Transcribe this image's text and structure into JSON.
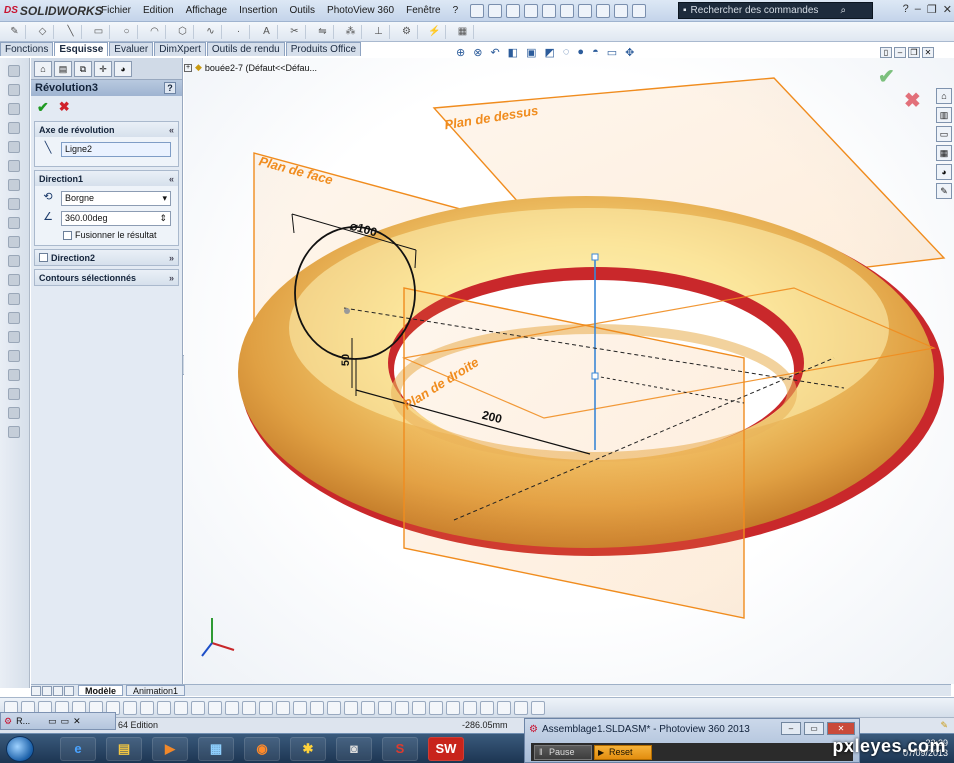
{
  "app": {
    "logo_prefix": "DS",
    "logo_name": "SOLIDWORKS"
  },
  "menu": [
    "Fichier",
    "Edition",
    "Affichage",
    "Insertion",
    "Outils",
    "PhotoView 360",
    "Fenêtre",
    "?"
  ],
  "search": {
    "placeholder": "Rechercher des commandes"
  },
  "tabs": [
    "Fonctions",
    "Esquisse",
    "Evaluer",
    "DimXpert",
    "Outils de rendu",
    "Produits Office"
  ],
  "active_tab": "Esquisse",
  "feature": {
    "title": "Révolution3",
    "help": "?",
    "axis_group": "Axe de révolution",
    "axis_value": "Ligne2",
    "direction1_group": "Direction1",
    "end_condition": "Borgne",
    "angle": "360.00deg",
    "merge_label": "Fusionner le résultat",
    "direction2_group": "Direction2",
    "contours_group": "Contours sélectionnés"
  },
  "viewport": {
    "tree_root": "bouée2-7  (Défaut<<Défau...",
    "plane_top": "Plan de dessus",
    "plane_front": "Plan de face",
    "plane_right": "Plan de droite",
    "dim_diameter": "⌀100",
    "dim_radius": "200",
    "dim_small": "50"
  },
  "model_tabs": [
    "Modèle",
    "Animation1"
  ],
  "status": {
    "edition": "64 Edition",
    "coord": "-286.05mm"
  },
  "mini_window": {
    "label": "R..."
  },
  "photoview": {
    "title": "Assemblage1.SLDASM* - Photoview 360 2013",
    "pause": "Pause",
    "reset": "Reset"
  },
  "clock": {
    "time": "22:39",
    "date": "07/09/2013"
  },
  "watermark": "pxleyes.com",
  "colors": {
    "plane": "#f08c1e",
    "torus_light": "#fff3a8",
    "torus_mid": "#f2c25a",
    "torus_dark": "#d48a2c",
    "edge_red": "#c8282a",
    "accent_blue": "#2c5c9b"
  }
}
